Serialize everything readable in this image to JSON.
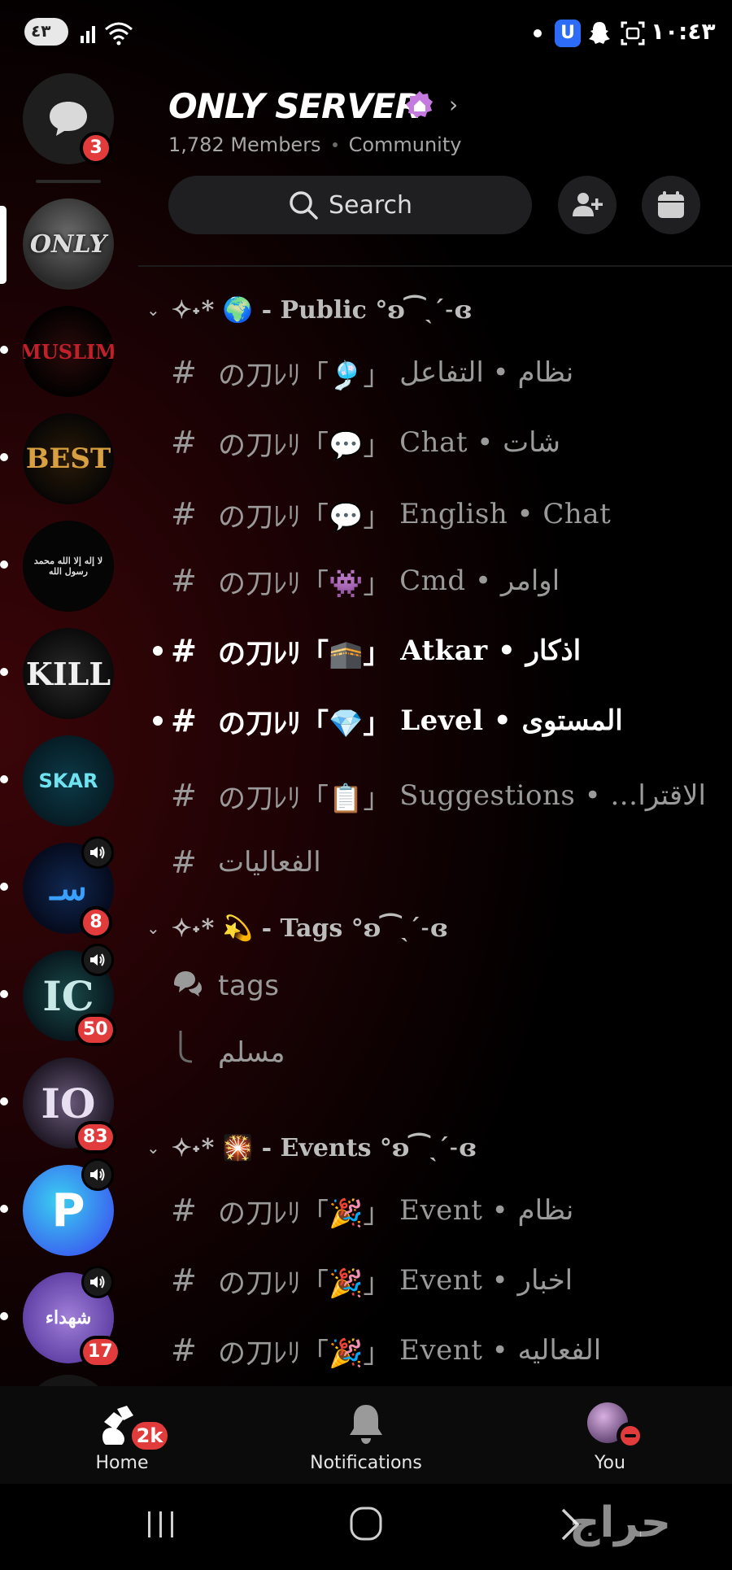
{
  "status_bar": {
    "pill_text": "٤٣",
    "time": "١٠:٤٣",
    "wifi_label": "5"
  },
  "server_rail": {
    "dm_badge": "3",
    "servers": [
      {
        "label": "ONLY",
        "active": true
      },
      {
        "label": "MUSLIM"
      },
      {
        "label": "BEST"
      },
      {
        "label": "لا إله إلا الله محمد رسول الله"
      },
      {
        "label": "KILL"
      },
      {
        "label": "SKAR"
      },
      {
        "label": "سـ",
        "badge": "8",
        "voice": true
      },
      {
        "label": "IC",
        "badge": "50",
        "voice": true
      },
      {
        "label": "IO",
        "badge": "83"
      },
      {
        "label": "P",
        "voice": true
      },
      {
        "label": "شهداء",
        "badge": "17",
        "voice": true
      }
    ]
  },
  "header": {
    "title": "ONLY SERVER",
    "members": "1,782 Members",
    "community": "Community",
    "search_label": "Search"
  },
  "categories": {
    "public": {
      "prefix": "✧˖*",
      "emoji": "🌍",
      "name": "- Public",
      "suffix": "°ʚ⁀ˎˊ˗ɞ"
    },
    "tags": {
      "prefix": "✧˖*",
      "emoji": "💫",
      "name": "- Tags",
      "suffix": "°ʚ⁀ˎˊ˗ɞ"
    },
    "events": {
      "prefix": "✧˖*",
      "emoji": "🎇",
      "name": "- Events",
      "suffix": "°ʚ⁀ˎˊ˗ɞ"
    }
  },
  "channels": {
    "c1": {
      "deco": "の刀ﾚﾘ「🎐」",
      "name": "نظام • التفاعل"
    },
    "c2": {
      "deco": "の刀ﾚﾘ「💬」",
      "name": "Chat • شات"
    },
    "c3": {
      "deco": "の刀ﾚﾘ「💬」",
      "name": "English • Chat"
    },
    "c4": {
      "deco": "の刀ﾚﾘ「👾」",
      "name": "Cmd • اوامر"
    },
    "c5": {
      "deco": "の刀ﾚﾘ「🕋」",
      "name": "Atkar • اذكار"
    },
    "c6": {
      "deco": "の刀ﾚﾘ「💎」",
      "name": "Level • المستوى"
    },
    "c7": {
      "deco": "の刀ﾚﾘ「📋」",
      "name": "Suggestions • ...الاقترا"
    },
    "c8": {
      "deco": "",
      "name": "الفعاليات"
    },
    "forum": {
      "name": "tags"
    },
    "thread": {
      "name": "مسلم"
    },
    "e1": {
      "deco": "の刀ﾚﾘ「🎉」",
      "name": "Event • نظام"
    },
    "e2": {
      "deco": "の刀ﾚﾘ「🎉」",
      "name": "Event • اخبار"
    },
    "e3": {
      "deco": "の刀ﾚﾘ「🎉」",
      "name": "Event • الفعاليه"
    }
  },
  "bottom_nav": {
    "home": "Home",
    "home_badge": "2k",
    "notifications": "Notifications",
    "you": "You"
  },
  "watermark": "حراج"
}
